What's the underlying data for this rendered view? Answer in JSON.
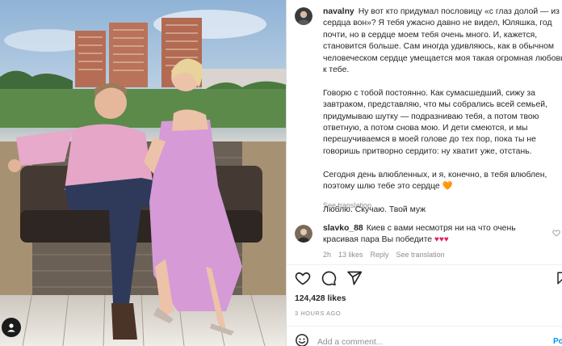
{
  "post": {
    "username": "navalny",
    "caption": [
      "Ну вот кто придумал пословицу «с глаз долой — из сердца вон»? Я тебя ужасно давно не видел, Юляшка, год почти, но в сердце моем тебя очень много. И, кажется, становится больше. Сам иногда удивляюсь, как в обычном человеческом сердце умещается моя такая огромная любовь к тебе.",
      "Говорю с тобой постоянно. Как сумасшедший, сижу за завтраком, представляю, что мы собрались всей семьей, придумываю шутку — подразниваю тебя, а потом твою ответную, а потом снова мою. И дети смеются, и мы перешучиваемся в моей голове до тех пор, пока ты не говоришь притворно сердито: ну хватит уже, отстань.",
      "Сегодня день влюбленных, и я, конечно, в тебя влюблен, поэтому шлю тебе это сердце 🧡",
      "Люблю. Скучаю. Твой муж"
    ],
    "see_translation": "See translation"
  },
  "comment": {
    "username": "slavko_88",
    "text": "Киев с вами несмотря ни на что очень красивая пара Вы победите",
    "hearts": "♥♥♥",
    "time": "2h",
    "likes": "13 likes",
    "reply": "Reply",
    "see_translation": "See translation"
  },
  "actions": {
    "likes_count": "124,428 likes",
    "time_ago": "3 HOURS AGO",
    "add_comment_placeholder": "Add a comment...",
    "post_label": "Po"
  }
}
